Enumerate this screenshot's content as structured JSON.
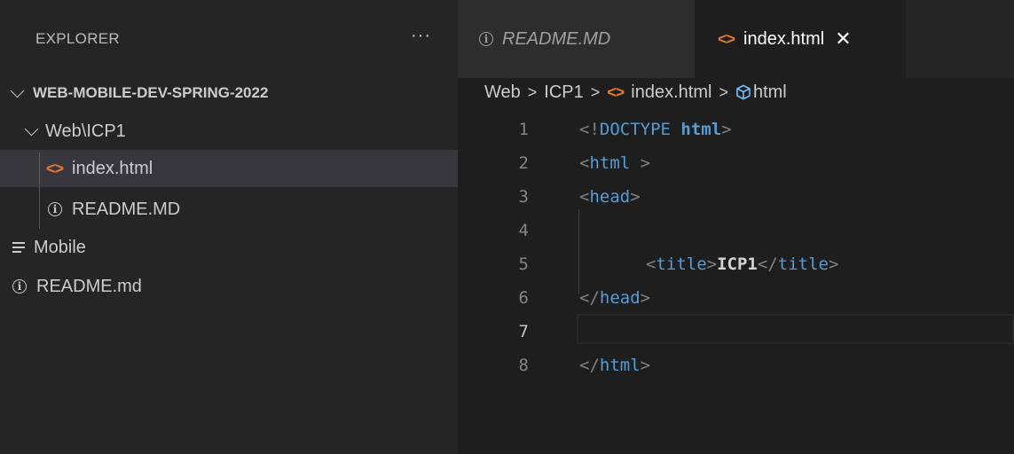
{
  "sidebar": {
    "title": "EXPLORER",
    "more_icon": "ellipsis-icon",
    "root_folder": "WEB-MOBILE-DEV-SPRING-2022",
    "tree": {
      "folder": "Web\\ICP1",
      "index_file": "index.html",
      "readme_file": "README.MD",
      "mobile": "Mobile",
      "root_readme": "README.md"
    }
  },
  "tabs": [
    {
      "label": "README.MD",
      "icon": "info-icon",
      "active": false,
      "italic": true
    },
    {
      "label": "index.html",
      "icon": "html-icon",
      "active": true,
      "close": "✕"
    }
  ],
  "breadcrumb": {
    "items": [
      "Web",
      "ICP1",
      "index.html",
      "html"
    ]
  },
  "editor": {
    "lines": [
      {
        "n": "1"
      },
      {
        "n": "2"
      },
      {
        "n": "3"
      },
      {
        "n": "4"
      },
      {
        "n": "5"
      },
      {
        "n": "6"
      },
      {
        "n": "7"
      },
      {
        "n": "8"
      }
    ],
    "code": {
      "l1_open": "<!",
      "l1_doctype": "DOCTYPE",
      "l1_html": "html",
      "l1_close": ">",
      "l2_open": "<",
      "l2_tag": "html",
      "l2_close": " >",
      "l3_open": "<",
      "l3_tag": "head",
      "l3_close": ">",
      "l5_open": "<",
      "l5_tag": "title",
      "l5_close": ">",
      "l5_text": "ICP1",
      "l5_end_open": "</",
      "l5_end_tag": "title",
      "l5_end_close": ">",
      "l6_open": "</",
      "l6_tag": "head",
      "l6_close": ">",
      "l8_open": "</",
      "l8_tag": "html",
      "l8_close": ">"
    }
  },
  "colors": {
    "html_icon": "#e37933",
    "tag": "#569cd6",
    "punctuation": "#808080",
    "sidebar_bg": "#252526",
    "editor_bg": "#1e1e1e",
    "selection": "#37373d"
  }
}
